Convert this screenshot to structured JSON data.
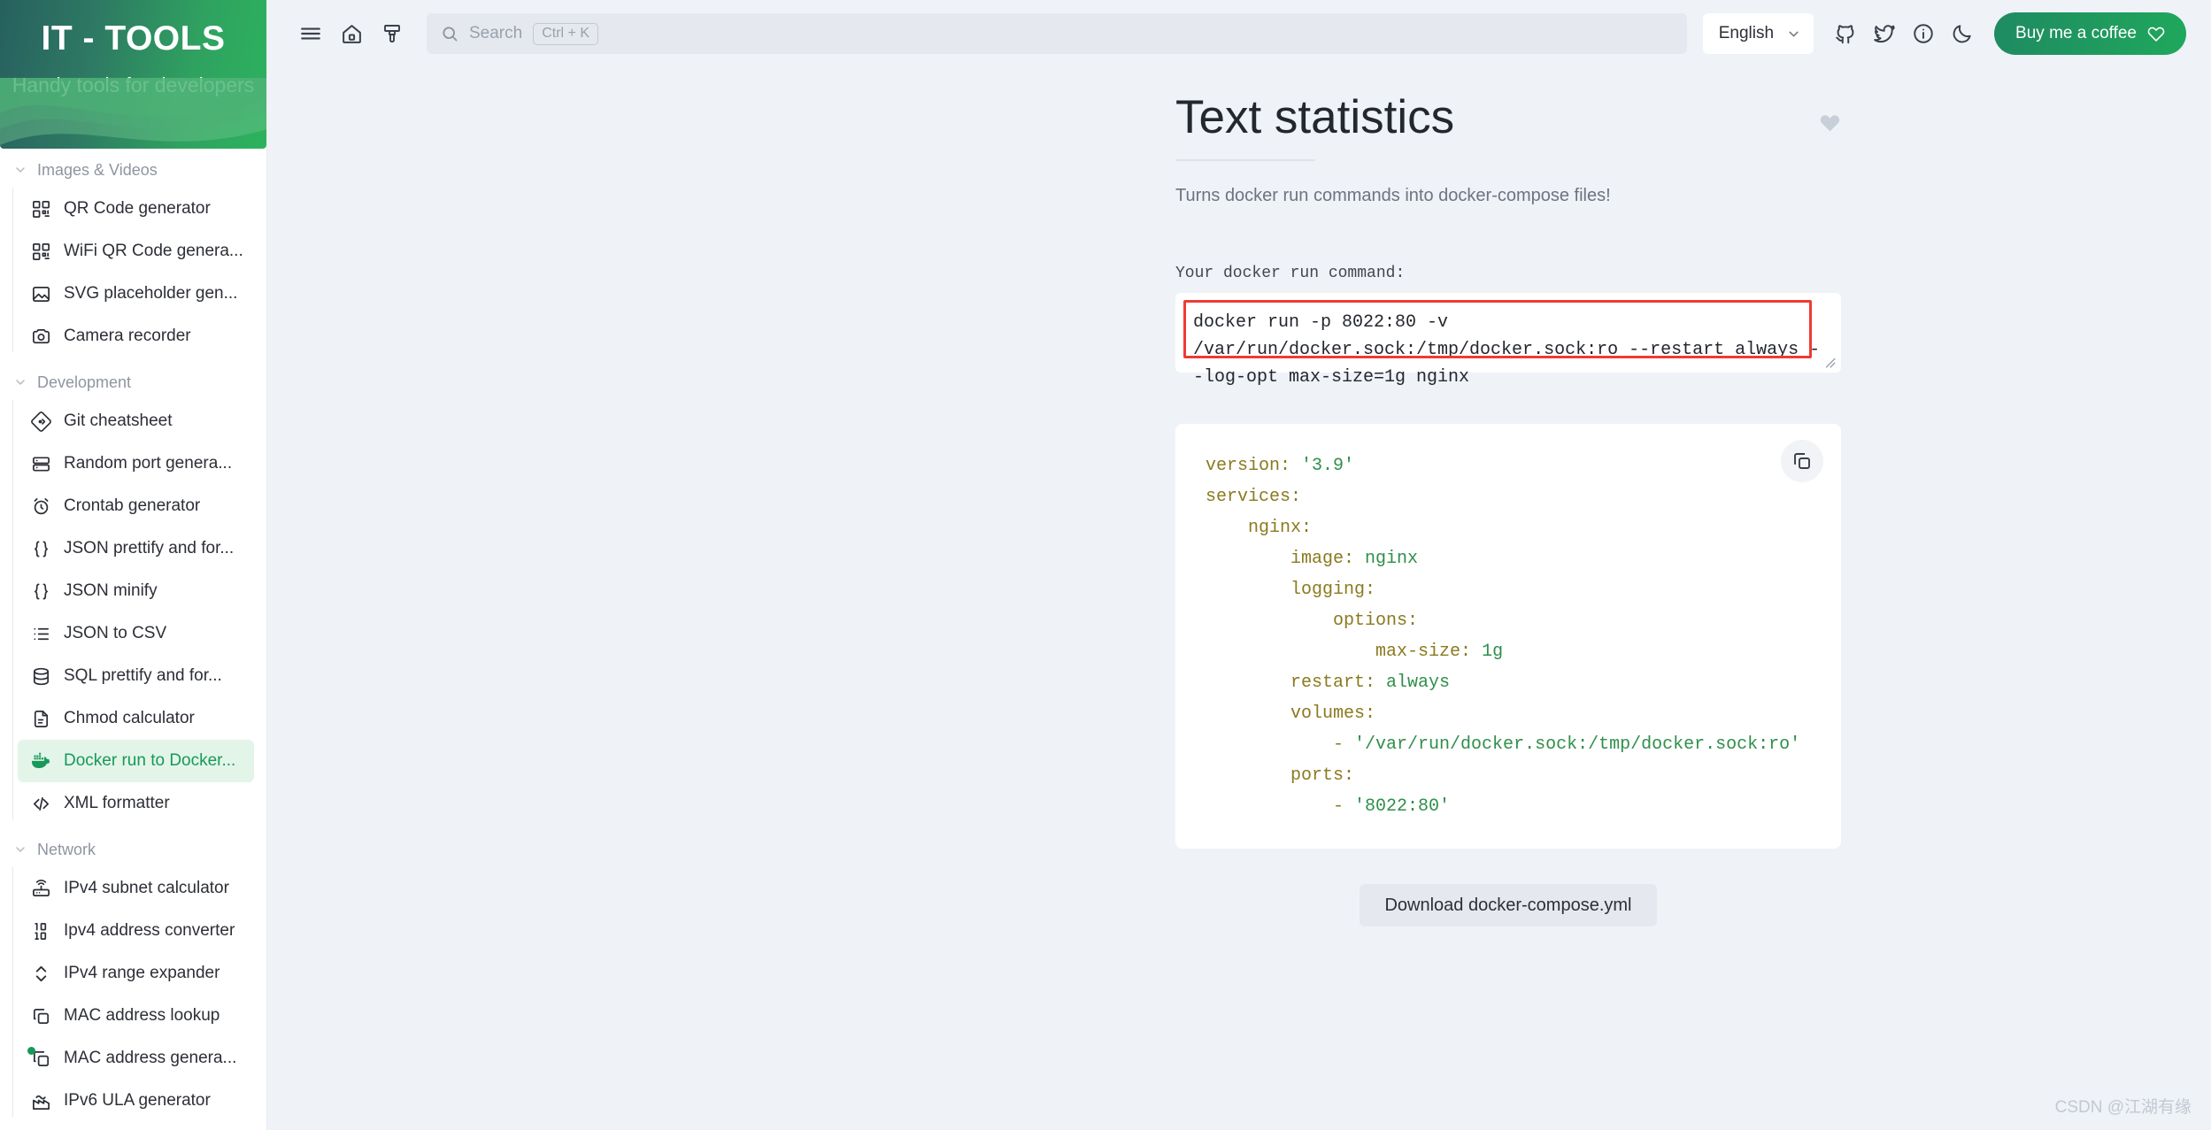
{
  "sidebar": {
    "brand_title": "IT - TOOLS",
    "brand_subtitle": "Handy tools for developers",
    "sections": [
      {
        "label": "Images & Videos",
        "items": [
          {
            "label": "QR Code generator",
            "icon": "qr-code-icon"
          },
          {
            "label": "WiFi QR Code genera...",
            "icon": "qr-code-icon"
          },
          {
            "label": "SVG placeholder gen...",
            "icon": "image-icon"
          },
          {
            "label": "Camera recorder",
            "icon": "camera-icon"
          }
        ]
      },
      {
        "label": "Development",
        "items": [
          {
            "label": "Git cheatsheet",
            "icon": "git-icon"
          },
          {
            "label": "Random port genera...",
            "icon": "server-icon"
          },
          {
            "label": "Crontab generator",
            "icon": "alarm-clock-icon"
          },
          {
            "label": "JSON prettify and for...",
            "icon": "braces-icon"
          },
          {
            "label": "JSON minify",
            "icon": "braces-icon"
          },
          {
            "label": "JSON to CSV",
            "icon": "list-icon"
          },
          {
            "label": "SQL prettify and for...",
            "icon": "database-icon"
          },
          {
            "label": "Chmod calculator",
            "icon": "file-icon"
          },
          {
            "label": "Docker run to Docker...",
            "icon": "docker-icon",
            "active": true
          },
          {
            "label": "XML formatter",
            "icon": "code-icon"
          }
        ]
      },
      {
        "label": "Network",
        "items": [
          {
            "label": "IPv4 subnet calculator",
            "icon": "router-icon"
          },
          {
            "label": "Ipv4 address converter",
            "icon": "binary-icon"
          },
          {
            "label": "IPv4 range expander",
            "icon": "chevrons-updown-icon"
          },
          {
            "label": "MAC address lookup",
            "icon": "copy-icon"
          },
          {
            "label": "MAC address genera...",
            "icon": "copy-icon",
            "badge": true
          },
          {
            "label": "IPv6 ULA generator",
            "icon": "factory-icon"
          }
        ]
      }
    ]
  },
  "topbar": {
    "menu_icon": "hamburger-menu-icon",
    "home_icon": "home-icon",
    "brush_icon": "paint-brush-icon",
    "search": {
      "icon": "search-icon",
      "placeholder": "Search",
      "shortcut": "Ctrl + K"
    },
    "language": {
      "value": "English",
      "chevron": "chevron-down-icon"
    },
    "icons": [
      {
        "name": "github-icon"
      },
      {
        "name": "twitter-icon"
      },
      {
        "name": "info-icon"
      },
      {
        "name": "moon-icon"
      }
    ],
    "coffee_button": {
      "label": "Buy me a coffee",
      "icon": "heart-icon"
    }
  },
  "page": {
    "title": "Text statistics",
    "subtitle": "Turns docker run commands into docker-compose files!",
    "favorite_icon": "heart-filled-icon",
    "input_label": "Your docker run command:",
    "input_value": "docker run -p 8022:80 -v /var/run/docker.sock:/tmp/docker.sock:ro --restart always --log-opt max-size=1g nginx",
    "copy_icon": "copy-icon",
    "output_lines": [
      {
        "indent": 0,
        "key": "version:",
        "value": " '3.9'"
      },
      {
        "indent": 0,
        "key": "services:",
        "value": ""
      },
      {
        "indent": 1,
        "key": "nginx:",
        "value": ""
      },
      {
        "indent": 2,
        "key": "image:",
        "value": " nginx"
      },
      {
        "indent": 2,
        "key": "logging:",
        "value": ""
      },
      {
        "indent": 3,
        "key": "options:",
        "value": ""
      },
      {
        "indent": 4,
        "key": "max-size:",
        "value": " 1g"
      },
      {
        "indent": 2,
        "key": "restart:",
        "value": " always"
      },
      {
        "indent": 2,
        "key": "volumes:",
        "value": ""
      },
      {
        "indent": 3,
        "key": "-",
        "value": " '/var/run/docker.sock:/tmp/docker.sock:ro'"
      },
      {
        "indent": 2,
        "key": "ports:",
        "value": ""
      },
      {
        "indent": 3,
        "key": "-",
        "value": " '8022:80'"
      }
    ],
    "download_label": "Download docker-compose.yml"
  },
  "watermark": "CSDN @江湖有缘",
  "colors": {
    "brand_green": "#19985a",
    "accent_red": "#ef3b33",
    "page_bg": "#eff2f7",
    "yaml_key": "#8a7a1f",
    "yaml_value": "#2f8f4a"
  }
}
